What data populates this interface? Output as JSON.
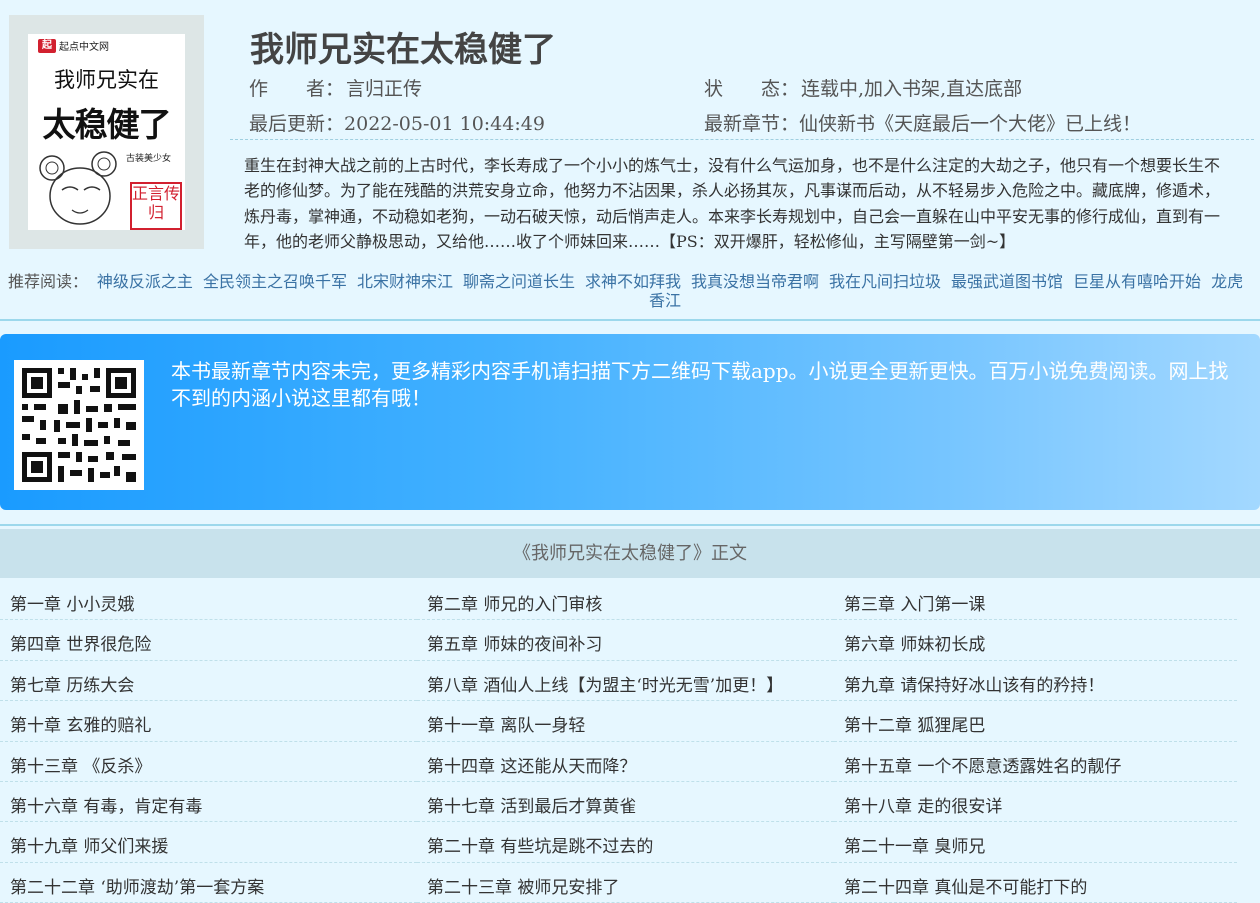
{
  "cover": {
    "logo_text": "起点中文网",
    "logo_mark": "起",
    "line1": "我师兄实在",
    "line2": "太稳健了",
    "subtitle": "古装美少女",
    "stamp": "正言传归"
  },
  "book": {
    "title": "我师兄实在太稳健了",
    "author_label": "作　　者：",
    "author": "言归正传",
    "status_label": "状　　态：",
    "status": "连载中,",
    "add_shelf": "加入书架",
    "sep": ",",
    "to_bottom": "直达底部",
    "update_label": "最后更新：",
    "update_time": "2022-05-01 10:44:49",
    "latest_label": "最新章节：",
    "latest_chapter": "仙侠新书《天庭最后一个大佬》已上线！",
    "intro": "重生在封神大战之前的上古时代，李长寿成了一个小小的炼气士，没有什么气运加身，也不是什么注定的大劫之子，他只有一个想要长生不老的修仙梦。为了能在残酷的洪荒安身立命，他努力不沾因果，杀人必扬其灰，凡事谋而后动，从不轻易步入危险之中。藏底牌，修遁术，炼丹毒，掌神通，不动稳如老狗，一动石破天惊，动后悄声走人。本来李长寿规划中，自己会一直躲在山中平安无事的修行成仙，直到有一年，他的老师父静极思动，又给他……收了个师妹回来……【PS：双开爆肝，轻松修仙，主写隔壁第一剑~】"
  },
  "recommend": {
    "label": "推荐阅读：",
    "items": [
      "神级反派之主",
      "全民领主之召唤千军",
      "北宋财神宋江",
      "聊斋之问道长生",
      "求神不如拜我",
      "我真没想当帝君啊",
      "我在凡间扫垃圾",
      "最强武道图书馆",
      "巨星从有嘻哈开始",
      "龙虎香江"
    ]
  },
  "banner": {
    "text": "本书最新章节内容未完，更多精彩内容手机请扫描下方二维码下载app。小说更全更新更快。百万小说免费阅读。网上找不到的内涵小说这里都有哦！"
  },
  "list": {
    "header": "《我师兄实在太稳健了》正文",
    "chapters": [
      "第一章 小小灵娥",
      "第二章 师兄的入门审核",
      "第三章 入门第一课",
      "第四章 世界很危险",
      "第五章 师妹的夜间补习",
      "第六章 师妹初长成",
      "第七章 历练大会",
      "第八章 酒仙人上线【为盟主‘时光无雪’加更！】",
      "第九章 请保持好冰山该有的矜持！",
      "第十章 玄雅的赔礼",
      "第十一章 离队一身轻",
      "第十二章 狐狸尾巴",
      "第十三章 《反杀》",
      "第十四章 这还能从天而降？",
      "第十五章 一个不愿意透露姓名的靓仔",
      "第十六章 有毒，肯定有毒",
      "第十七章 活到最后才算黄雀",
      "第十八章 走的很安详",
      "第十九章 师父们来援",
      "第二十章 有些坑是跳不过去的",
      "第二十一章 臭师兄",
      "第二十二章 ‘助师渡劫’第一套方案",
      "第二十三章 被师兄安排了",
      "第二十四章 真仙是不可能打下的"
    ]
  },
  "colors": {
    "page_bg": "#e6f7ff",
    "link": "#3a72a4",
    "header_bg": "#c8e2ec",
    "banner_start": "#1a9bff",
    "banner_end": "#a3d8ff"
  }
}
